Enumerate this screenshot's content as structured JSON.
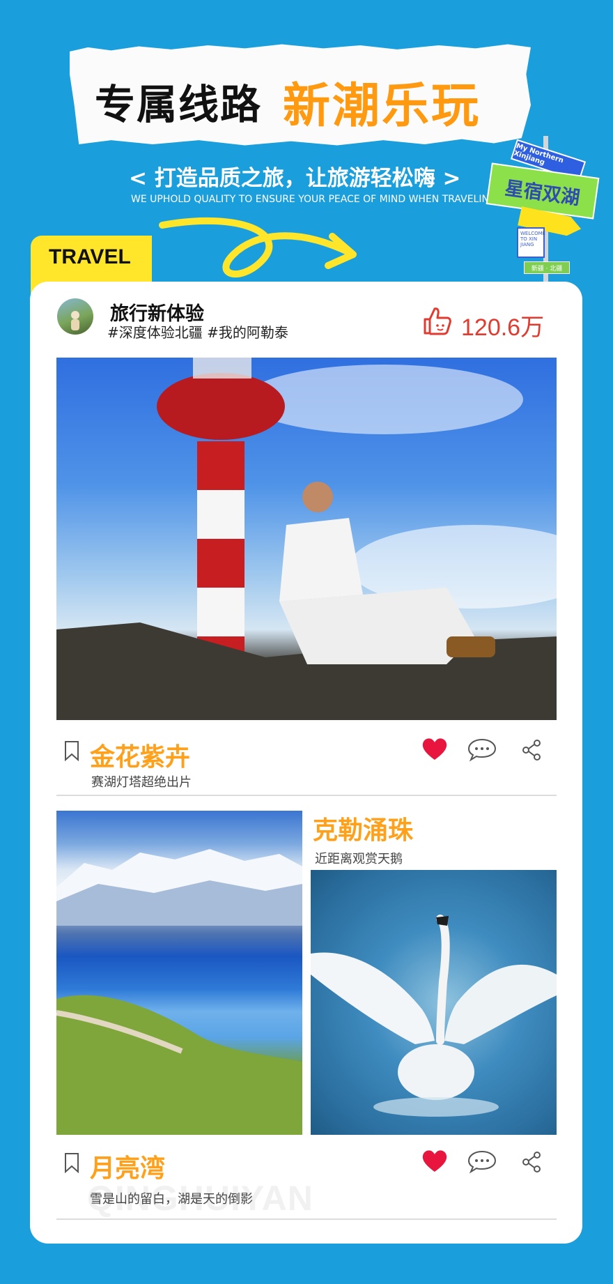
{
  "banner": {
    "title_black": "专属线路",
    "title_orange": "新潮乐玩",
    "slogan": "< 打造品质之旅，让旅游轻松嗨 >",
    "slogan_en": "WE UPHOLD QUALITY TO ENSURE YOUR PEACE OF MIND WHEN TRAVELING"
  },
  "signpost": {
    "sign_top": "My Northern Xinjiang",
    "sign_main": "星宿双湖",
    "sign_welcome": "WELCOME TO XIN JIANG",
    "sign_bottom": "新疆 · 北疆"
  },
  "tag": "TRAVEL",
  "post": {
    "username": "旅行新体验",
    "hashtags": "#深度体验北疆 #我的阿勒泰",
    "likes": "120.6万"
  },
  "items": [
    {
      "title": "金花紫卉",
      "subtitle": "赛湖灯塔超绝出片"
    },
    {
      "title": "克勒涌珠",
      "subtitle": "近距离观赏天鹅"
    },
    {
      "title": "月亮湾",
      "subtitle": "雪是山的留白，湖是天的倒影"
    }
  ],
  "watermark": "QINGHUIYAN",
  "colors": {
    "background": "#1a9fdc",
    "accent_orange": "#ffa01a",
    "heart": "#e8153e",
    "likes": "#e23a2e",
    "tag_yellow": "#ffe62a"
  },
  "icons": [
    "bookmark-icon",
    "heart-icon",
    "comment-icon",
    "share-icon",
    "thumbs-up-icon"
  ]
}
